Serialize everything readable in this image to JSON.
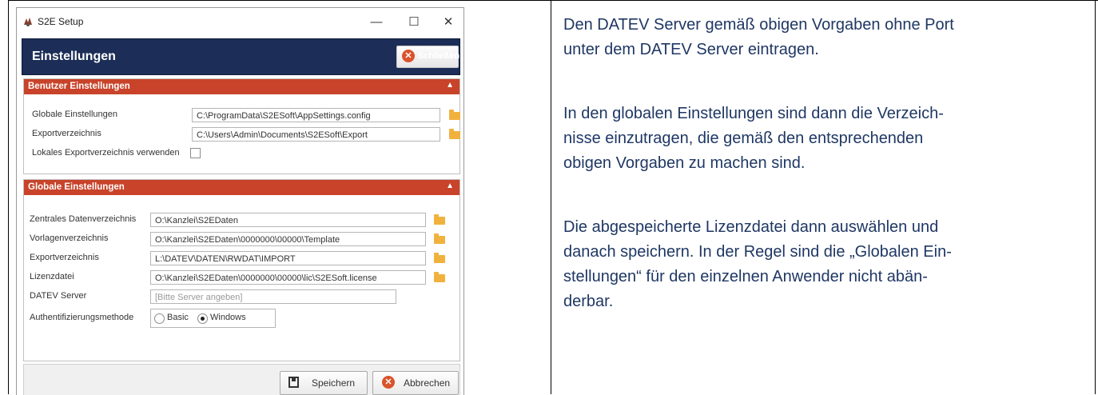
{
  "window": {
    "title": "S2E Setup",
    "minimize": "—",
    "maximize": "☐",
    "close": "✕"
  },
  "header": {
    "title": "Einstellungen",
    "close_label": "Schließen"
  },
  "benutzer": {
    "title": "Benutzer Einstellungen",
    "rows": [
      {
        "label": "Globale Einstellungen",
        "value": "C:\\ProgramData\\S2ESoft\\AppSettings.config"
      },
      {
        "label": "Exportverzeichnis",
        "value": "C:\\Users\\Admin\\Documents\\S2ESoft\\Export"
      }
    ],
    "local_export_label": "Lokales Exportverzeichnis verwenden"
  },
  "global": {
    "title": "Globale Einstellungen",
    "rows": [
      {
        "label": "Zentrales Datenverzeichnis",
        "value": "O:\\Kanzlei\\S2EDaten"
      },
      {
        "label": "Vorlagenverzeichnis",
        "value": "O:\\Kanzlei\\S2EDaten\\0000000\\00000\\Template"
      },
      {
        "label": "Exportverzeichnis",
        "value": "L:\\DATEV\\DATEN\\RWDAT\\IMPORT"
      },
      {
        "label": "Lizenzdatei",
        "value": "O:\\Kanzlei\\S2EDaten\\0000000\\00000\\lic\\S2ESoft.license"
      }
    ],
    "server_label": "DATEV Server",
    "server_placeholder": "[Bitte Server angeben]",
    "auth_label": "Authentifizierungsmethode",
    "auth_basic": "Basic",
    "auth_windows": "Windows",
    "auth_selected": "Windows"
  },
  "footer": {
    "save_label": "Speichern",
    "cancel_label": "Abbrechen"
  },
  "description": {
    "p1_l1": "Den DATEV Server gemäß obigen Vorgaben ohne Port",
    "p1_l2": "unter dem DATEV Server eintragen.",
    "p2_l1": "In den globalen Einstellungen sind dann die Verzeich-",
    "p2_l2": "nisse einzutragen, die gemäß den entsprechenden",
    "p2_l3": "obigen Vorgaben zu machen sind.",
    "p3_l1": "Die abgespeicherte Lizenzdatei dann auswählen und",
    "p3_l2": "danach speichern. In der Regel sind die „Globalen Ein-",
    "p3_l3": "stellungen“ für den einzelnen Anwender nicht abän-",
    "p3_l4": "derbar."
  }
}
